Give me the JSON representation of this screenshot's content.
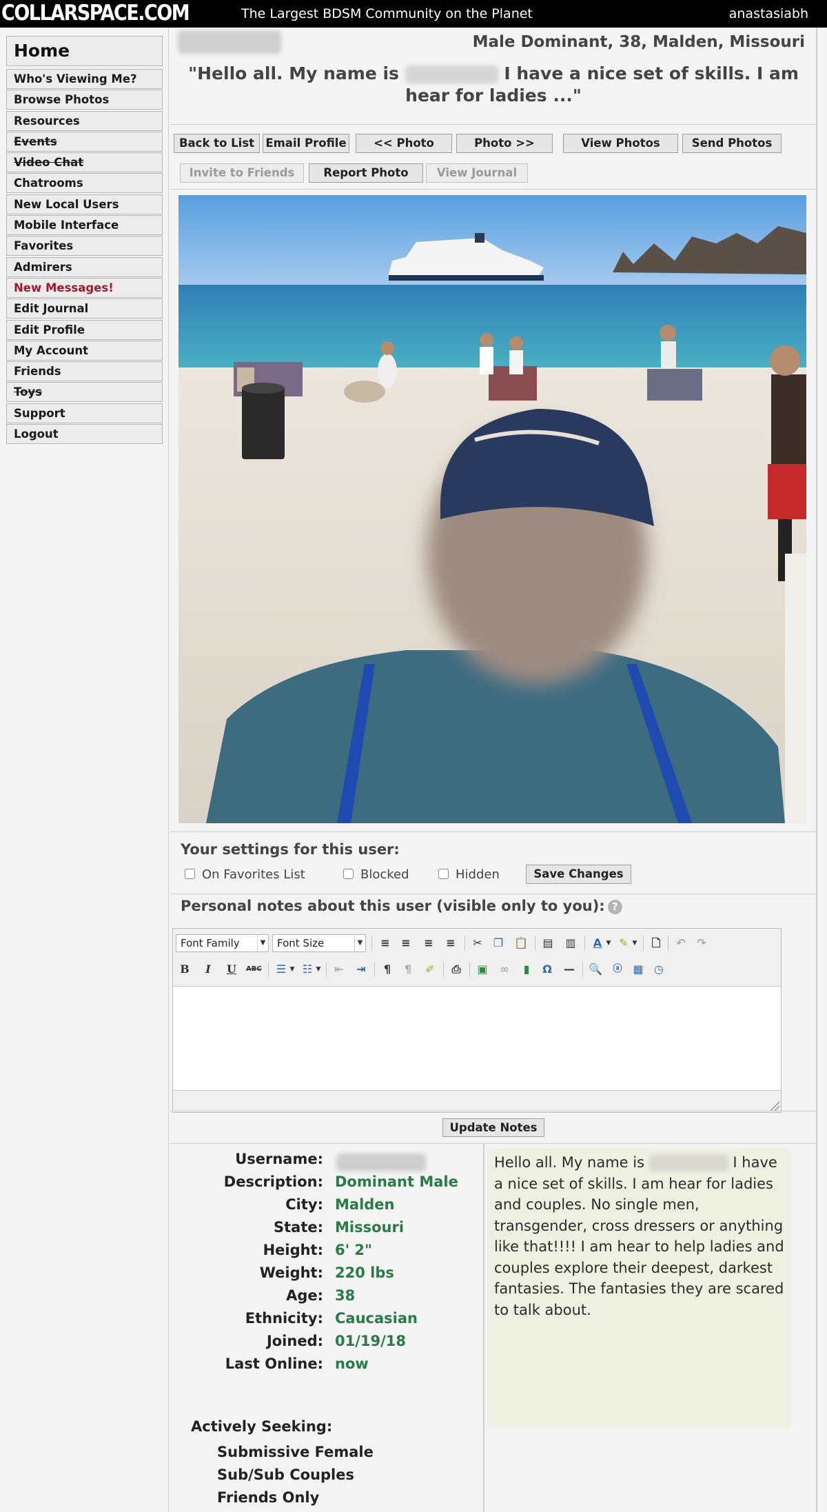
{
  "header": {
    "logo": "COLLARSPACE.COM",
    "tagline": "The Largest BDSM Community on the Planet",
    "username": "anastasiabh"
  },
  "sidebar": {
    "home": "Home",
    "items": [
      {
        "label": "Who's Viewing Me?"
      },
      {
        "label": "Browse Photos"
      },
      {
        "label": "Resources"
      },
      {
        "label": "Events",
        "struck": true
      },
      {
        "label": "Video Chat",
        "struck": true
      },
      {
        "label": "Chatrooms"
      },
      {
        "label": "New Local Users"
      },
      {
        "label": "Mobile Interface"
      },
      {
        "label": "Favorites"
      },
      {
        "label": "Admirers"
      },
      {
        "label": "New Messages!",
        "highlight": true
      },
      {
        "label": "Edit Journal"
      },
      {
        "label": "Edit Profile"
      },
      {
        "label": "My Account"
      },
      {
        "label": "Friends"
      },
      {
        "label": "Toys",
        "struck": true
      },
      {
        "label": "Support"
      },
      {
        "label": "Logout"
      }
    ]
  },
  "profile": {
    "heading": "Male Dominant, 38,  Malden, Missouri",
    "quote_before": "\"Hello all.  My name is",
    "quote_after": "I have a nice set of skills.  I am hear for ladies ...\""
  },
  "buttons": {
    "back_to_list": "Back to List",
    "email_profile": "Email Profile",
    "prev_photo": "<< Photo",
    "next_photo": "Photo >>",
    "view_photos": "View Photos",
    "send_photos": "Send Photos",
    "invite_friends": "Invite to Friends",
    "report_photo": "Report Photo",
    "view_journal": "View Journal",
    "save_changes": "Save Changes",
    "update_notes": "Update Notes"
  },
  "settings": {
    "title": "Your settings for this user:",
    "favorites": "On Favorites List",
    "blocked": "Blocked",
    "hidden": "Hidden"
  },
  "notes": {
    "title": "Personal notes about this user (visible only to you):",
    "help_icon": "?",
    "font_family": "Font Family",
    "font_size": "Font Size"
  },
  "details": {
    "rows": [
      {
        "label": "Username:",
        "value": ""
      },
      {
        "label": "Description:",
        "value": "Dominant Male"
      },
      {
        "label": "City:",
        "value": "Malden"
      },
      {
        "label": "State:",
        "value": "Missouri"
      },
      {
        "label": "Height:",
        "value": "6' 2\""
      },
      {
        "label": "Weight:",
        "value": "220 lbs"
      },
      {
        "label": "Age:",
        "value": "38"
      },
      {
        "label": "Ethnicity:",
        "value": "Caucasian"
      },
      {
        "label": "Joined:",
        "value": "01/19/18"
      },
      {
        "label": "Last Online:",
        "value": "now"
      }
    ],
    "seeking_label": "Actively Seeking:",
    "seeking": [
      "Submissive Female",
      "Sub/Sub Couples",
      "Friends Only"
    ],
    "bio_before": "Hello all.  My name is",
    "bio_after": "I have a nice set of skills.  I am hear for ladies and couples.  No single men, transgender, cross dressers or anything like that!!!!  I am hear to help ladies and couples explore their deepest, darkest fantasies.  The fantasies they are scared to talk about."
  },
  "colors": {
    "value_green": "#2a7a45",
    "new_messages": "#9b1b30",
    "bio_background": "#eef0e1"
  }
}
